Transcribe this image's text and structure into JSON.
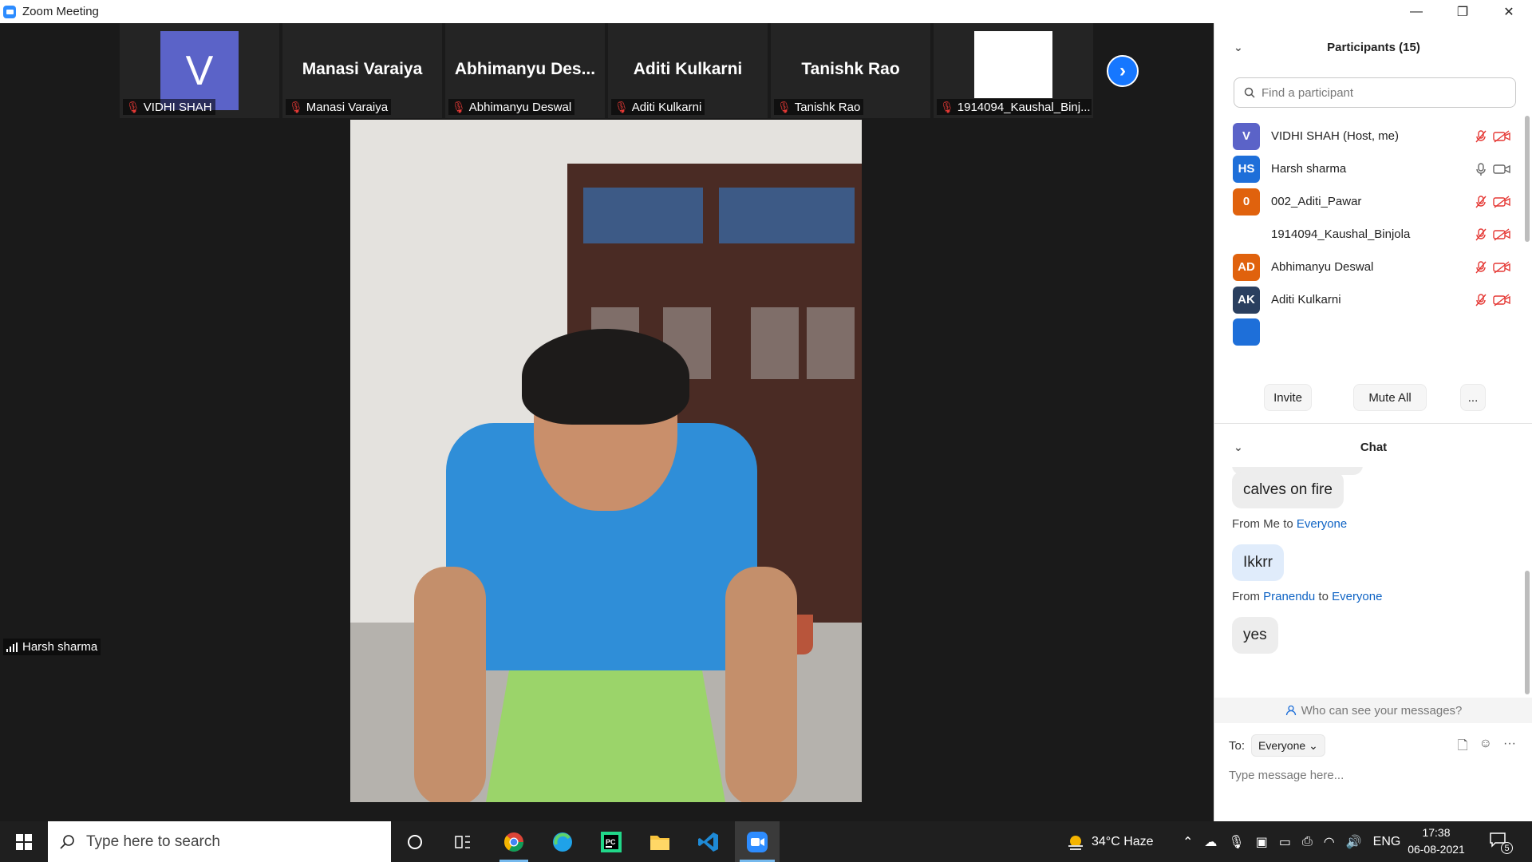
{
  "window": {
    "title": "Zoom Meeting",
    "minimize": "—",
    "restore": "❐",
    "close": "✕"
  },
  "strip": {
    "tiles": [
      {
        "avatar_letter": "V",
        "big_name": "",
        "label": "VIDHI SHAH",
        "avatar_color": "#5b63c8"
      },
      {
        "avatar_letter": "",
        "big_name": "Manasi Varaiya",
        "label": "Manasi Varaiya"
      },
      {
        "avatar_letter": "",
        "big_name": "Abhimanyu Des...",
        "label": "Abhimanyu Deswal"
      },
      {
        "avatar_letter": "",
        "big_name": "Aditi Kulkarni",
        "label": "Aditi Kulkarni"
      },
      {
        "avatar_letter": "",
        "big_name": "Tanishk Rao",
        "label": "Tanishk Rao"
      },
      {
        "avatar_letter": "",
        "big_name": "",
        "label": "1914094_Kaushal_Binj..."
      }
    ],
    "next_icon": "chevron-right-icon"
  },
  "active_speaker": {
    "name": "Harsh sharma"
  },
  "participants": {
    "title": "Participants (15)",
    "search_placeholder": "Find a participant",
    "list": [
      {
        "initials": "V",
        "name": "VIDHI SHAH (Host, me)",
        "color": "#5b63c8",
        "muted": true,
        "video_off": true
      },
      {
        "initials": "HS",
        "name": "Harsh sharma",
        "color": "#1e6fd9",
        "muted": false,
        "video_off": false
      },
      {
        "initials": "0",
        "name": "002_Aditi_Pawar",
        "color": "#e0620d",
        "muted": true,
        "video_off": true
      },
      {
        "initials": "",
        "name": "1914094_Kaushal_Binjola",
        "color": "#ffffff",
        "muted": true,
        "video_off": true
      },
      {
        "initials": "AD",
        "name": "Abhimanyu Deswal",
        "color": "#e0620d",
        "muted": true,
        "video_off": true
      },
      {
        "initials": "AK",
        "name": "Aditi Kulkarni",
        "color": "#2a3f5f",
        "muted": true,
        "video_off": true
      }
    ],
    "invite_label": "Invite",
    "mute_all_label": "Mute All",
    "more_label": "..."
  },
  "chat": {
    "title": "Chat",
    "messages": [
      {
        "from": "",
        "to": "",
        "text": "calves on fire",
        "mine": false
      },
      {
        "from": "Me",
        "to": "Everyone",
        "text": "Ikkrr",
        "mine": true
      },
      {
        "from": "Pranendu",
        "to": "Everyone",
        "text": "yes",
        "mine": false
      }
    ],
    "from_prefix": "From",
    "to_word": "to",
    "who_can_see": "Who can see your messages?",
    "to_label": "To:",
    "recipient": "Everyone",
    "input_placeholder": "Type message here..."
  },
  "taskbar": {
    "search_placeholder": "Type here to search",
    "weather": "34°C  Haze",
    "language": "ENG",
    "time": "17:38",
    "date": "06-08-2021",
    "notifications": "5"
  },
  "colors": {
    "accent": "#1677ff",
    "muted_red": "#e53935",
    "link": "#0e63c4"
  }
}
